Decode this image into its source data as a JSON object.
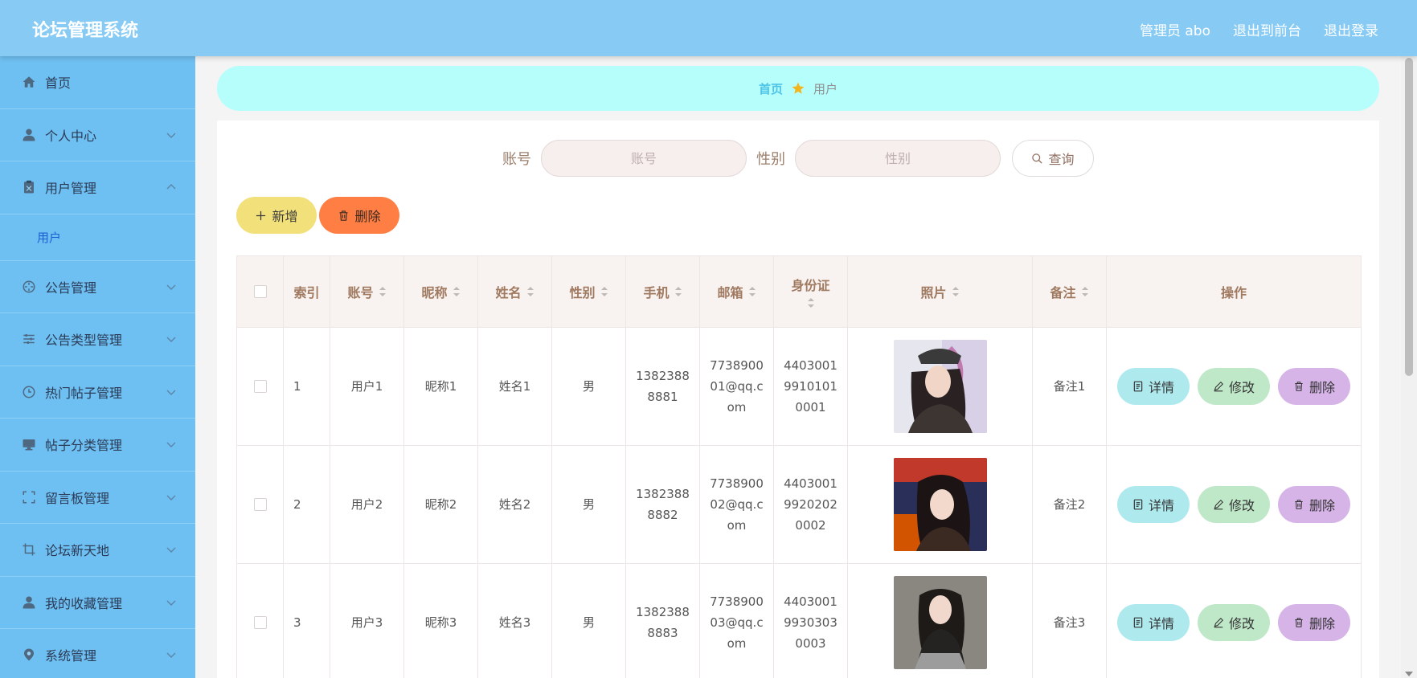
{
  "app": {
    "title": "论坛管理系统"
  },
  "header": {
    "nav": [
      {
        "label": "管理员 abo"
      },
      {
        "label": "退出到前台"
      },
      {
        "label": "退出登录"
      }
    ]
  },
  "sidebar": {
    "items": [
      {
        "label": "首页",
        "icon": "home-icon",
        "expandable": false
      },
      {
        "label": "个人中心",
        "icon": "user-icon",
        "expandable": true
      },
      {
        "label": "用户管理",
        "icon": "clipboard-icon",
        "expandable": true,
        "expanded": true
      },
      {
        "label": "公告管理",
        "icon": "compass-icon",
        "expandable": true
      },
      {
        "label": "公告类型管理",
        "icon": "sliders-icon",
        "expandable": true
      },
      {
        "label": "热门帖子管理",
        "icon": "clock-icon",
        "expandable": true
      },
      {
        "label": "帖子分类管理",
        "icon": "monitor-icon",
        "expandable": true
      },
      {
        "label": "留言板管理",
        "icon": "fullscreen-icon",
        "expandable": true
      },
      {
        "label": "论坛新天地",
        "icon": "crop-icon",
        "expandable": true
      },
      {
        "label": "我的收藏管理",
        "icon": "user-icon",
        "expandable": true
      },
      {
        "label": "系统管理",
        "icon": "location-icon",
        "expandable": true
      }
    ],
    "sub_item": {
      "label": "用户"
    }
  },
  "breadcrumb": {
    "home": "首页",
    "current": "用户",
    "separator_icon": "star-icon"
  },
  "search": {
    "account_label": "账号",
    "account_placeholder": "账号",
    "gender_label": "性别",
    "gender_placeholder": "性别",
    "button_label": "查询"
  },
  "actions": {
    "add_label": "新增",
    "delete_label": "删除"
  },
  "table": {
    "columns": {
      "index": "索引",
      "account": "账号",
      "nickname": "昵称",
      "name": "姓名",
      "gender": "性别",
      "phone": "手机",
      "email": "邮箱",
      "idcard": "身份证",
      "photo": "照片",
      "remark": "备注",
      "ops": "操作"
    },
    "rows": [
      {
        "index": "1",
        "account": "用户1",
        "nickname": "昵称1",
        "name": "姓名1",
        "gender": "男",
        "phone": "13823888881",
        "email": "773890001@qq.com",
        "idcard": "440300199101010001",
        "remark": "备注1"
      },
      {
        "index": "2",
        "account": "用户2",
        "nickname": "昵称2",
        "name": "姓名2",
        "gender": "男",
        "phone": "13823888882",
        "email": "773890002@qq.com",
        "idcard": "440300199202020002",
        "remark": "备注2"
      },
      {
        "index": "3",
        "account": "用户3",
        "nickname": "昵称3",
        "name": "姓名3",
        "gender": "男",
        "phone": "13823888883",
        "email": "773890003@qq.com",
        "idcard": "440300199303030003",
        "remark": "备注3"
      }
    ],
    "op_labels": {
      "detail": "详情",
      "edit": "修改",
      "delete": "删除"
    }
  },
  "colors": {
    "header_bg": "#87cbf5",
    "sidebar_bg": "#6fc0f2",
    "breadcrumb_bg": "#b6fefc",
    "add_button": "#f2e07a",
    "delete_button": "#ff7e43",
    "detail_button": "#aee9ee",
    "edit_button": "#bfe8c8",
    "row_delete_button": "#d6b4e8"
  }
}
